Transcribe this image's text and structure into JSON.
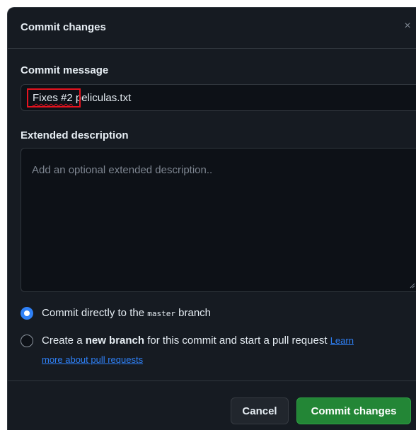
{
  "dialog": {
    "title": "Commit changes",
    "close_glyph": "×"
  },
  "commit_message": {
    "label": "Commit message",
    "value_highlighted": "Fixes #2",
    "value_rest": " peliculas.txt"
  },
  "extended_description": {
    "label": "Extended description",
    "placeholder": "Add an optional extended description.."
  },
  "options": {
    "direct": {
      "text_before": "Commit directly to the ",
      "branch": "master",
      "text_after": " branch",
      "selected": true
    },
    "new_branch": {
      "text_before": "Create a ",
      "bold": "new branch",
      "text_after": " for this commit and start a pull request ",
      "link_part1": "Learn",
      "link_part2": "more about pull requests",
      "selected": false
    }
  },
  "footer": {
    "cancel_label": "Cancel",
    "commit_label": "Commit changes"
  },
  "colors": {
    "background": "#161b22",
    "accent_blue": "#2f81f7",
    "commit_green": "#238636",
    "highlight_red": "#e5131f"
  }
}
